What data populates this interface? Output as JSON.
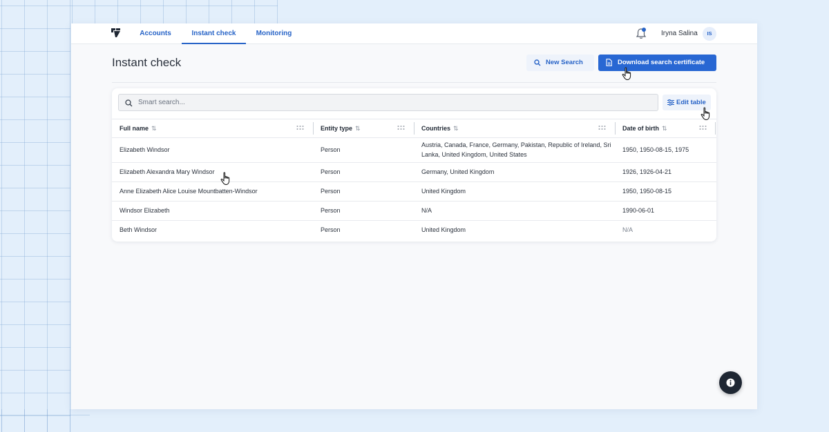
{
  "nav": {
    "tabs": [
      {
        "label": "Accounts"
      },
      {
        "label": "Instant check"
      },
      {
        "label": "Monitoring"
      }
    ],
    "active_tab": "Instant check",
    "user_name": "Iryna Salina",
    "avatar_initials": "IS"
  },
  "page": {
    "title": "Instant check",
    "new_search_label": "New Search",
    "download_label": "Download search certificate"
  },
  "search": {
    "placeholder": "Smart search...",
    "value": ""
  },
  "edit_table_label": "Edit table",
  "table": {
    "columns": [
      "Full name",
      "Entity type",
      "Countries",
      "Date of birth"
    ],
    "rows": [
      {
        "name": "Elizabeth Windsor",
        "type": "Person",
        "countries": "Austria, Canada, France, Germany, Pakistan, Republic of Ireland, Sri Lanka, United Kingdom, United States",
        "dob": "1950, 1950-08-15, 1975"
      },
      {
        "name": "Elizabeth Alexandra Mary Windsor",
        "type": "Person",
        "countries": "Germany, United Kingdom",
        "dob": "1926, 1926-04-21"
      },
      {
        "name": "Anne Elizabeth Alice Louise Mountbatten-Windsor",
        "type": "Person",
        "countries": "United Kingdom",
        "dob": "1950, 1950-08-15"
      },
      {
        "name": "Windsor Elizabeth",
        "type": "Person",
        "countries": "N/A",
        "dob": "1990-06-01"
      },
      {
        "name": "Beth Windsor",
        "type": "Person",
        "countries": "United Kingdom",
        "dob": "N/A"
      }
    ]
  },
  "colors": {
    "accent": "#2864c7",
    "primary_button": "#2867d3",
    "text": "#2a313c"
  },
  "icons": {
    "logo": "brand-logo",
    "bell": "bell-icon",
    "search": "search-icon",
    "document": "document-icon",
    "sliders": "sliders-icon",
    "sort": "sort-arrows-icon",
    "grip": "drag-grip-icon",
    "info": "info-icon"
  }
}
